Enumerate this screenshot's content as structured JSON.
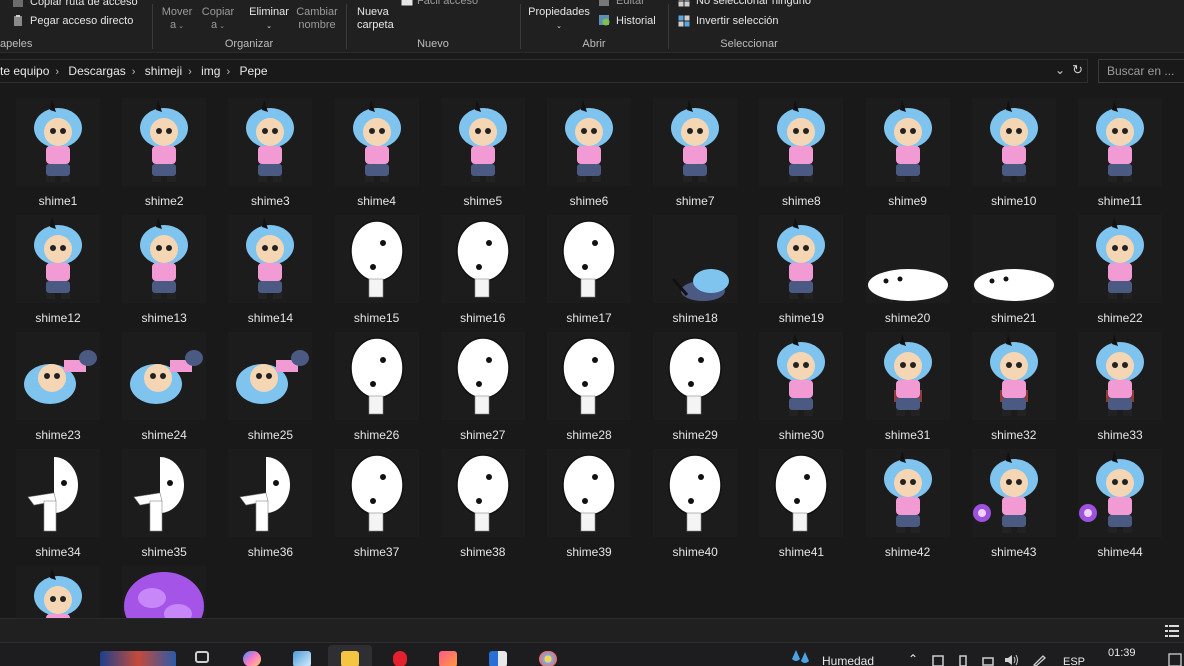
{
  "ribbon": {
    "clipboard": {
      "copy_path": "Copiar ruta de acceso",
      "paste_shortcut": "Pegar acceso directo",
      "group": "apeles"
    },
    "organize": {
      "move_line1": "Mover",
      "move_line2": "a",
      "copy_line1": "Copiar",
      "copy_line2": "a",
      "delete": "Eliminar",
      "rename_line1": "Cambiar",
      "rename_line2": "nombre",
      "group": "Organizar"
    },
    "new": {
      "new_folder_line1": "Nueva",
      "new_folder_line2": "carpeta",
      "easy_access": "Fácil acceso",
      "group": "Nuevo"
    },
    "open": {
      "properties": "Propiedades",
      "edit": "Editar",
      "history": "Historial",
      "group": "Abrir"
    },
    "select": {
      "select_none": "No seleccionar ninguno",
      "invert": "Invertir selección",
      "group": "Seleccionar"
    }
  },
  "address": {
    "crumbs": [
      "te equipo",
      "Descargas",
      "shimeji",
      "img",
      "Pepe"
    ]
  },
  "search": {
    "placeholder": "Buscar en ..."
  },
  "files": [
    {
      "name": "shime1",
      "kind": "char"
    },
    {
      "name": "shime2",
      "kind": "char"
    },
    {
      "name": "shime3",
      "kind": "char"
    },
    {
      "name": "shime4",
      "kind": "char"
    },
    {
      "name": "shime5",
      "kind": "char"
    },
    {
      "name": "shime6",
      "kind": "char"
    },
    {
      "name": "shime7",
      "kind": "char"
    },
    {
      "name": "shime8",
      "kind": "char"
    },
    {
      "name": "shime9",
      "kind": "char"
    },
    {
      "name": "shime10",
      "kind": "char"
    },
    {
      "name": "shime11",
      "kind": "char"
    },
    {
      "name": "shime12",
      "kind": "char"
    },
    {
      "name": "shime13",
      "kind": "char"
    },
    {
      "name": "shime14",
      "kind": "char"
    },
    {
      "name": "shime15",
      "kind": "blob"
    },
    {
      "name": "shime16",
      "kind": "blob"
    },
    {
      "name": "shime17",
      "kind": "blob"
    },
    {
      "name": "shime18",
      "kind": "char-low"
    },
    {
      "name": "shime19",
      "kind": "char"
    },
    {
      "name": "shime20",
      "kind": "flat"
    },
    {
      "name": "shime21",
      "kind": "flat"
    },
    {
      "name": "shime22",
      "kind": "char"
    },
    {
      "name": "shime23",
      "kind": "char-side"
    },
    {
      "name": "shime24",
      "kind": "char-side"
    },
    {
      "name": "shime25",
      "kind": "char-side"
    },
    {
      "name": "shime26",
      "kind": "blob"
    },
    {
      "name": "shime27",
      "kind": "blob"
    },
    {
      "name": "shime28",
      "kind": "blob"
    },
    {
      "name": "shime29",
      "kind": "blob"
    },
    {
      "name": "shime30",
      "kind": "char"
    },
    {
      "name": "shime31",
      "kind": "char-read"
    },
    {
      "name": "shime32",
      "kind": "char-read"
    },
    {
      "name": "shime33",
      "kind": "char-read"
    },
    {
      "name": "shime34",
      "kind": "half"
    },
    {
      "name": "shime35",
      "kind": "half"
    },
    {
      "name": "shime36",
      "kind": "half"
    },
    {
      "name": "shime37",
      "kind": "blob"
    },
    {
      "name": "shime38",
      "kind": "blob"
    },
    {
      "name": "shime39",
      "kind": "blob"
    },
    {
      "name": "shime40",
      "kind": "blob"
    },
    {
      "name": "shime41",
      "kind": "blob"
    },
    {
      "name": "shime42",
      "kind": "char"
    },
    {
      "name": "shime43",
      "kind": "char-magic"
    },
    {
      "name": "shime44",
      "kind": "char-magic"
    },
    {
      "name": "",
      "kind": "char-magic"
    },
    {
      "name": "",
      "kind": "cloud"
    }
  ],
  "taskbar": {
    "weather": "Humedad",
    "lang": "ESP",
    "time": "01:39"
  },
  "colors": {
    "hair": "#7fc4ef",
    "shirt": "#f29ad4",
    "pants": "#4b5a82",
    "magic": "#b45cff"
  }
}
